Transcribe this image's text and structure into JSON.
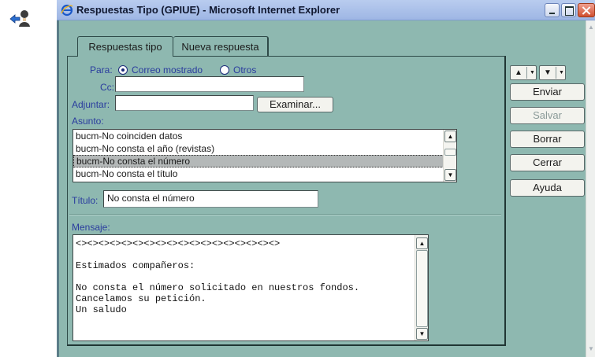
{
  "window": {
    "title": "Respuestas Tipo (GPIUE) - Microsoft Internet Explorer"
  },
  "tabs": [
    {
      "label": "Respuestas tipo",
      "active": true
    },
    {
      "label": "Nueva respuesta",
      "active": false
    }
  ],
  "form": {
    "para_label": "Para:",
    "para_options": [
      {
        "label": "Correo mostrado",
        "checked": true
      },
      {
        "label": "Otros",
        "checked": false
      }
    ],
    "cc_label": "Cc:",
    "cc_value": "",
    "adjuntar_label": "Adjuntar:",
    "adjuntar_value": "",
    "examinar_label": "Examinar...",
    "asunto_label": "Asunto:",
    "asunto_items": [
      "bucm-No coinciden datos",
      "bucm-No consta el año (revistas)",
      "bucm-No consta el número",
      "bucm-No consta el título"
    ],
    "asunto_selected_index": 2,
    "titulo_label": "Título:",
    "titulo_value": "No consta el número",
    "mensaje_label": "Mensaje:",
    "mensaje_text": "<><><><><><><><><><><><><><><><><><>\n\nEstimados compañeros:\n\nNo consta el número solicitado en nuestros fondos.\nCancelamos su petición.\nUn saludo"
  },
  "actions": {
    "enviar": "Enviar",
    "salvar": "Salvar",
    "borrar": "Borrar",
    "cerrar": "Cerrar",
    "ayuda": "Ayuda"
  },
  "colors": {
    "panel_bg": "#8eb8b0",
    "titlebar": "#9eb6e4",
    "label_blue": "#2a3c9e"
  }
}
